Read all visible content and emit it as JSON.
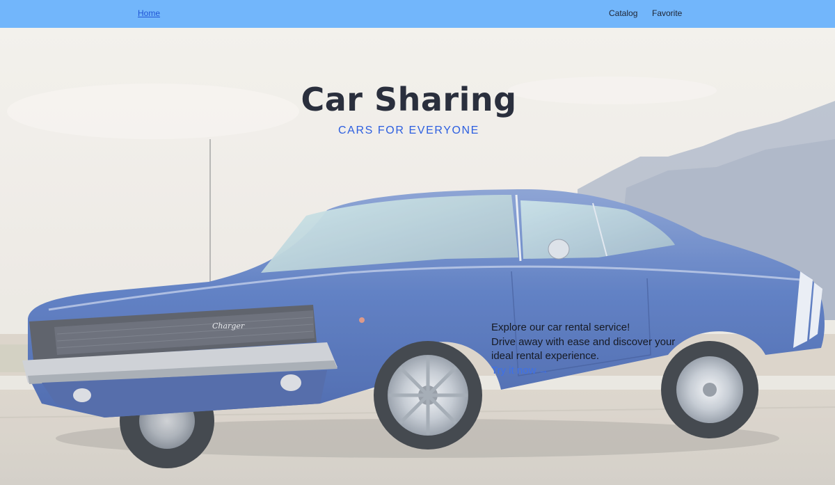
{
  "nav": {
    "home": "Home",
    "catalog": "Catalog",
    "favorite": "Favorite"
  },
  "hero": {
    "title": "Car Sharing",
    "subtitle": "CARS FOR EVERYONE",
    "promo_line1": "Explore our car rental service!",
    "promo_line2": "Drive away with ease and discover your",
    "promo_line3": "ideal rental experience.",
    "cta": "Try it now",
    "cta_icon": "arrow-right-icon"
  },
  "colors": {
    "nav_bg": "#72b6fb",
    "accent": "#2c5ee0",
    "title": "#2a2f3d",
    "car_body": "#3b63b4"
  }
}
